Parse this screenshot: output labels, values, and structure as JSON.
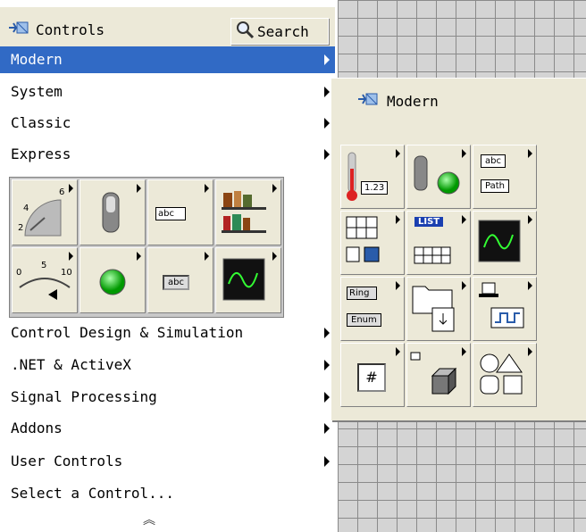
{
  "header": {
    "title": "Controls",
    "search_label": "Search"
  },
  "menu": {
    "top_items": [
      {
        "label": "Modern"
      },
      {
        "label": "System"
      },
      {
        "label": "Classic"
      },
      {
        "label": "Express"
      }
    ],
    "bottom_items": [
      {
        "label": "Control Design & Simulation"
      },
      {
        "label": ".NET & ActiveX"
      },
      {
        "label": "Signal Processing"
      },
      {
        "label": "Addons"
      },
      {
        "label": "User Controls"
      },
      {
        "label": "Select a Control..."
      }
    ]
  },
  "express_icons": {
    "text_abc_1": "abc",
    "text_abc_2": "abc",
    "slide_ticks": [
      "0",
      "5",
      "10"
    ],
    "knob_ticks": [
      "2",
      "4",
      "6"
    ]
  },
  "submenu": {
    "title": "Modern",
    "numeric_value": "1.23",
    "string_labels": [
      "abc",
      "Path"
    ],
    "ring_label": "Ring",
    "enum_label": "Enum",
    "list_label": "LIST",
    "ref_symbol": "#"
  },
  "colors": {
    "selection": "#316ac5",
    "panel": "#ece9d8"
  }
}
